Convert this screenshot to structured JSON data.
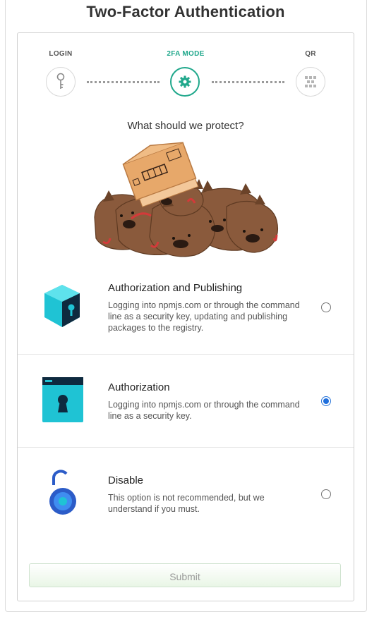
{
  "page": {
    "title": "Two-Factor Authentication"
  },
  "steps": [
    {
      "label": "LOGIN",
      "icon": "key-icon",
      "active": false
    },
    {
      "label": "2FA MODE",
      "icon": "gear-icon",
      "active": true
    },
    {
      "label": "QR",
      "icon": "qr-code-icon",
      "active": false
    }
  ],
  "colors": {
    "active_step": "#21a88c",
    "radio_checked": "#1f6fdd",
    "submit_bg": "#e9f6e6"
  },
  "question": "What should we protect?",
  "options": [
    {
      "title": "Authorization and Publishing",
      "description": "Logging into npmjs.com or through the command line as a security key, updating and publishing packages to the registry.",
      "icon": "locked-cube-icon",
      "checked": false
    },
    {
      "title": "Authorization",
      "description": "Logging into npmjs.com or through the command line as a security key.",
      "icon": "locked-window-icon",
      "checked": true
    },
    {
      "title": "Disable",
      "description": "This option is not recommended, but we understand if you must.",
      "icon": "unlocked-padlock-icon",
      "checked": false
    }
  ],
  "submit": {
    "label": "Submit"
  }
}
